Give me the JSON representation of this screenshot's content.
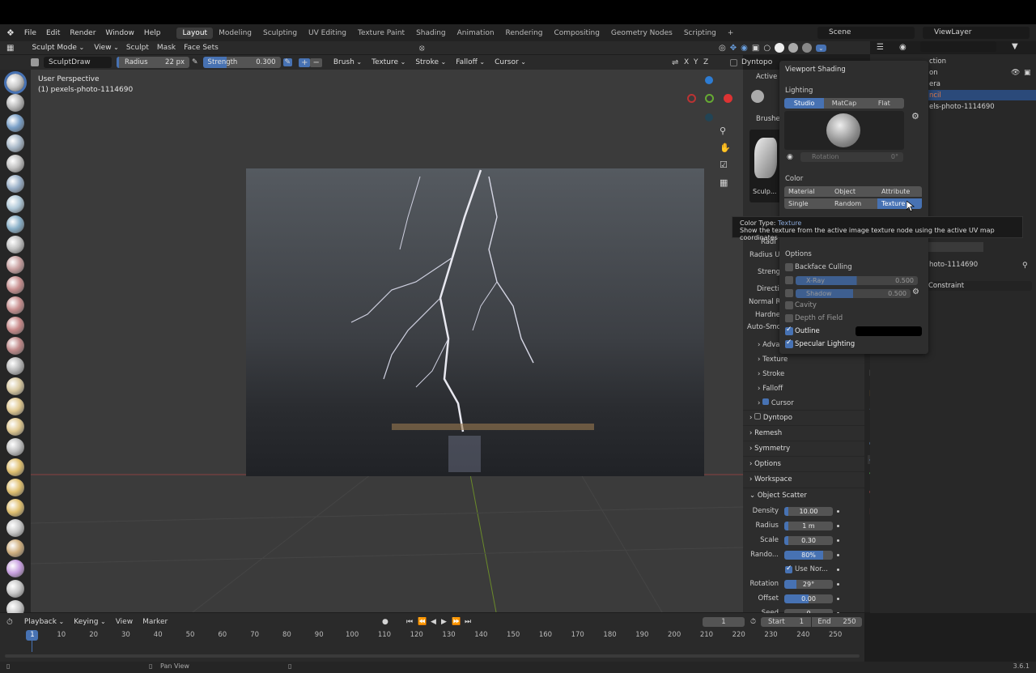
{
  "menu": {
    "file": "File",
    "edit": "Edit",
    "render": "Render",
    "window": "Window",
    "help": "Help"
  },
  "workspaces": [
    "Layout",
    "Modeling",
    "Sculpting",
    "UV Editing",
    "Texture Paint",
    "Shading",
    "Animation",
    "Rendering",
    "Compositing",
    "Geometry Nodes",
    "Scripting"
  ],
  "scene": "Scene",
  "view_layer": "ViewLayer",
  "header": {
    "mode": "Sculpt Mode",
    "view": "View",
    "sculpt": "Sculpt",
    "mask": "Mask",
    "face_sets": "Face Sets"
  },
  "tool_header": {
    "brush_name": "SculptDraw",
    "radius_label": "Radius",
    "radius_value": "22 px",
    "strength_label": "Strength",
    "strength_value": "0.300",
    "brush": "Brush",
    "texture": "Texture",
    "stroke": "Stroke",
    "falloff": "Falloff",
    "cursor": "Cursor",
    "axes": [
      "X",
      "Y",
      "Z"
    ],
    "dyntopo": "Dyntopo"
  },
  "viewport": {
    "perspective": "User Perspective",
    "object": "(1) pexels-photo-1114690"
  },
  "props": {
    "active_tool": "Active T",
    "brushes": "Brushes",
    "brush_thumb": "Sculp...",
    "radius": "Radi",
    "radius_unit": "Radius Ur",
    "strength": "Strengt",
    "direction": "Directi",
    "normal_radius": "Normal R",
    "hardness": "Hardnes",
    "autosmooth": "Auto-Smo",
    "advanced": "Adva",
    "texture": "Texture",
    "stroke": "Stroke",
    "falloff": "Falloff",
    "cursor": "Cursor",
    "dyntopo": "Dyntopo",
    "remesh": "Remesh",
    "symmetry": "Symmetry",
    "options": "Options",
    "workspace": "Workspace",
    "object_scatter": "Object Scatter"
  },
  "scatter": [
    {
      "label": "Density",
      "value": "10.00",
      "fill": 0.08
    },
    {
      "label": "Radius",
      "value": "1 m",
      "fill": 0.08
    },
    {
      "label": "Scale",
      "value": "0.30",
      "fill": 0.08
    },
    {
      "label": "Rando...",
      "value": "80%",
      "fill": 0.8
    },
    {
      "label": "",
      "value": "Use Nor...",
      "check": true
    },
    {
      "label": "Rotation",
      "value": "29°",
      "fill": 0.25
    },
    {
      "label": "Offset",
      "value": "0.00",
      "fill": 0.5
    },
    {
      "label": "Seed",
      "value": "0",
      "fill": 0
    }
  ],
  "outliner": {
    "collection": "ction",
    "camera": "era",
    "light": "ncil",
    "image": "els-photo-1114690",
    "object": "hoto-1114690",
    "constraint": "Constraint",
    "item0": "on"
  },
  "shading": {
    "title": "Viewport Shading",
    "lighting": "Lighting",
    "lighting_modes": [
      "Studio",
      "MatCap",
      "Flat"
    ],
    "rotation_label": "Rotation",
    "rotation_value": "0°",
    "color": "Color",
    "color_modes_row1": [
      "Material",
      "Object",
      "Attribute"
    ],
    "color_modes_row2": [
      "Single",
      "Random",
      "Texture"
    ],
    "options": "Options",
    "backface": "Backface Culling",
    "xray": "X-Ray",
    "xray_value": "0.500",
    "shadow": "Shadow",
    "shadow_value": "0.500",
    "cavity": "Cavity",
    "dof": "Depth of Field",
    "outline": "Outline",
    "specular": "Specular Lighting"
  },
  "tooltip": {
    "label": "Color Type:",
    "value": "Texture",
    "desc": "Show the texture from the active image texture node using the active UV map coordinates"
  },
  "timeline": {
    "playback": "Playback",
    "keying": "Keying",
    "view": "View",
    "marker": "Marker",
    "current": "1",
    "start_label": "Start",
    "start": "1",
    "end_label": "End",
    "end": "250",
    "ticks": [
      "1",
      "10",
      "20",
      "30",
      "40",
      "50",
      "60",
      "70",
      "80",
      "90",
      "100",
      "110",
      "120",
      "130",
      "140",
      "150",
      "160",
      "170",
      "180",
      "190",
      "200",
      "210",
      "220",
      "230",
      "240",
      "250"
    ]
  },
  "status": {
    "pan": "Pan View",
    "version": "3.6.1"
  },
  "colors": {
    "accent": "#4772b3",
    "bg": "#1d1d1d",
    "panel": "#2d2d2d"
  }
}
